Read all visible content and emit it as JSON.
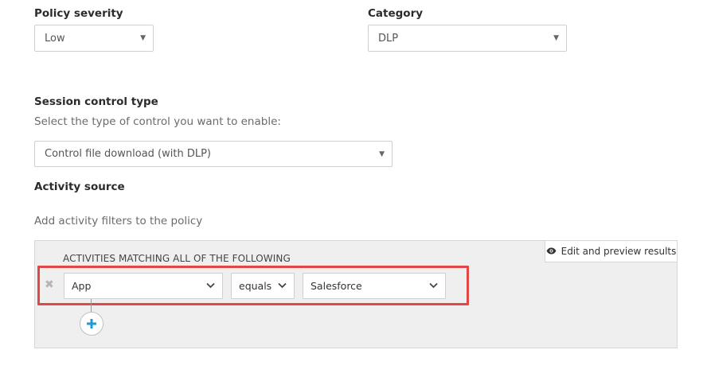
{
  "policy_severity": {
    "label": "Policy severity",
    "value": "Low"
  },
  "category": {
    "label": "Category",
    "value": "DLP"
  },
  "session_control": {
    "label": "Session control type",
    "hint": "Select the type of control you want to enable:",
    "value": "Control file download (with DLP)"
  },
  "activity_source": {
    "label": "Activity source",
    "hint": "Add activity filters to the policy",
    "edit_button": "Edit and preview results",
    "match_title": "ACTIVITIES MATCHING ALL OF THE FOLLOWING",
    "filter": {
      "field": "App",
      "operator": "equals",
      "value": "Salesforce"
    }
  },
  "colors": {
    "highlight": "#e04848",
    "add_icon": "#1e9ad6"
  },
  "icons": [
    "dropdown-caret-icon",
    "eye-icon",
    "chevron-down-icon",
    "remove-x-icon",
    "plus-icon"
  ]
}
